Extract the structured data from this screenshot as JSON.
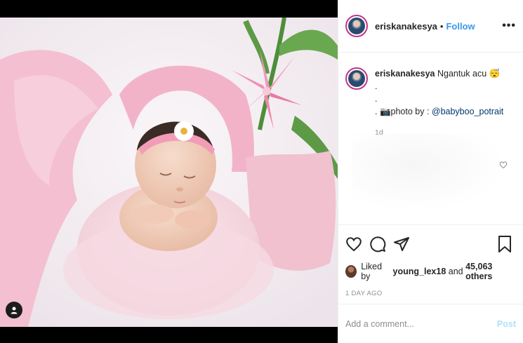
{
  "post": {
    "username": "eriskanakesya",
    "separator": "•",
    "follow_label": "Follow",
    "more_label": "•••"
  },
  "caption": {
    "username": "eriskanakesya",
    "text": "Ngantuk acu",
    "emoji": "😴",
    "line2": ".",
    "line3": ".",
    "line4_prefix": ". 📷photo by : ",
    "mention": "@babyboo_potrait",
    "age": "1d"
  },
  "likes": {
    "prefix": "Liked by ",
    "user": "young_lex18",
    "middle": " and ",
    "count": "45,063 others"
  },
  "timestamp": "1 DAY AGO",
  "comment_box": {
    "placeholder": "Add a comment...",
    "post_label": "Post"
  },
  "colors": {
    "accent": "#3897f0",
    "post_disabled": "#b2dffc",
    "avatar_ring": "#c13584"
  },
  "icons": [
    "user-tag-icon",
    "heart-icon",
    "comment-icon",
    "share-icon",
    "bookmark-icon",
    "heart-small-icon"
  ]
}
